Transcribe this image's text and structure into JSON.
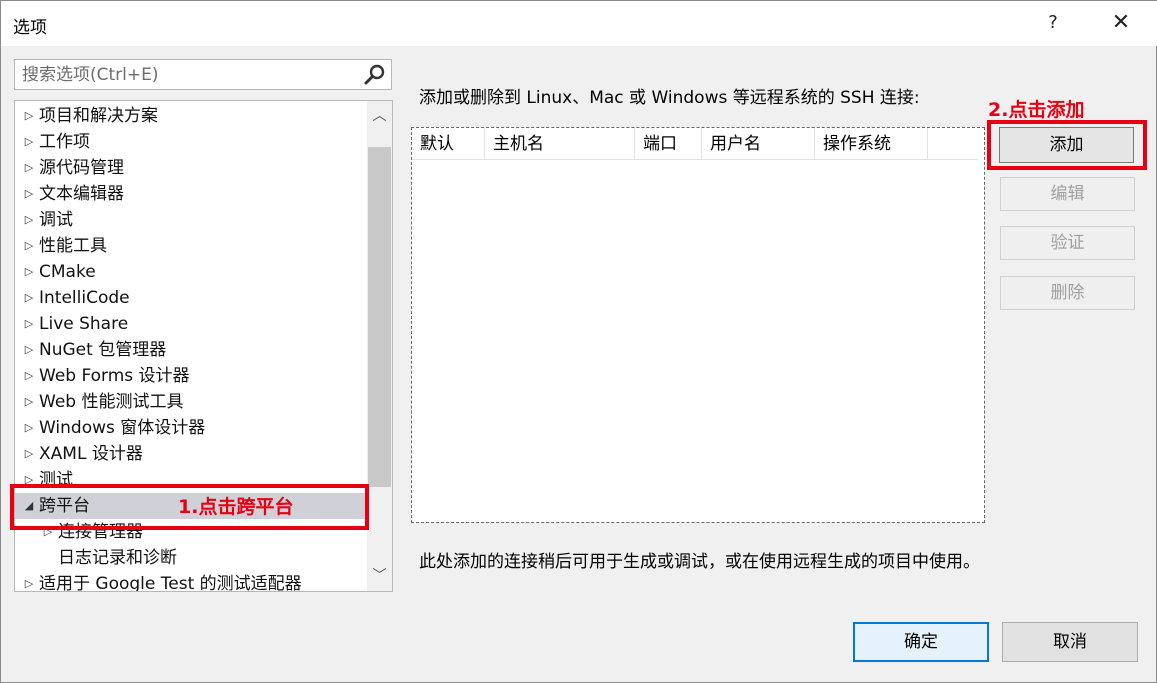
{
  "window": {
    "title": "选项",
    "help_label": "?",
    "close_label": "✕"
  },
  "search": {
    "placeholder": "搜索选项(Ctrl+E)",
    "icon": "search-icon"
  },
  "tree": {
    "items": [
      {
        "label": "项目和解决方案",
        "arrow": "▷"
      },
      {
        "label": "工作项",
        "arrow": "▷"
      },
      {
        "label": "源代码管理",
        "arrow": "▷"
      },
      {
        "label": "文本编辑器",
        "arrow": "▷"
      },
      {
        "label": "调试",
        "arrow": "▷"
      },
      {
        "label": "性能工具",
        "arrow": "▷"
      },
      {
        "label": "CMake",
        "arrow": "▷"
      },
      {
        "label": "IntelliCode",
        "arrow": "▷"
      },
      {
        "label": "Live Share",
        "arrow": "▷"
      },
      {
        "label": "NuGet 包管理器",
        "arrow": "▷"
      },
      {
        "label": "Web Forms 设计器",
        "arrow": "▷"
      },
      {
        "label": "Web 性能测试工具",
        "arrow": "▷"
      },
      {
        "label": "Windows 窗体设计器",
        "arrow": "▷"
      },
      {
        "label": "XAML 设计器",
        "arrow": "▷"
      },
      {
        "label": "测试",
        "arrow": "▷"
      },
      {
        "label": "跨平台",
        "arrow": "◢",
        "selected": true
      },
      {
        "label": "连接管理器",
        "arrow": "▷"
      },
      {
        "label": "日志记录和诊断",
        "arrow": ""
      },
      {
        "label": "适用于 Google Test 的测试适配器",
        "arrow": "▷"
      }
    ]
  },
  "main": {
    "description": "添加或删除到 Linux、Mac 或 Windows 等远程系统的 SSH 连接:",
    "columns": [
      "默认",
      "主机名",
      "端口",
      "用户名",
      "操作系统"
    ],
    "footer_note": "此处添加的连接稍后可用于生成或调试，或在使用远程生成的项目中使用。"
  },
  "buttons": {
    "add": "添加",
    "edit": "编辑",
    "verify": "验证",
    "delete": "删除",
    "ok": "确定",
    "cancel": "取消"
  },
  "annotations": {
    "step1": "1.点击跨平台",
    "step2": "2.点击添加",
    "color": "#e60012"
  }
}
